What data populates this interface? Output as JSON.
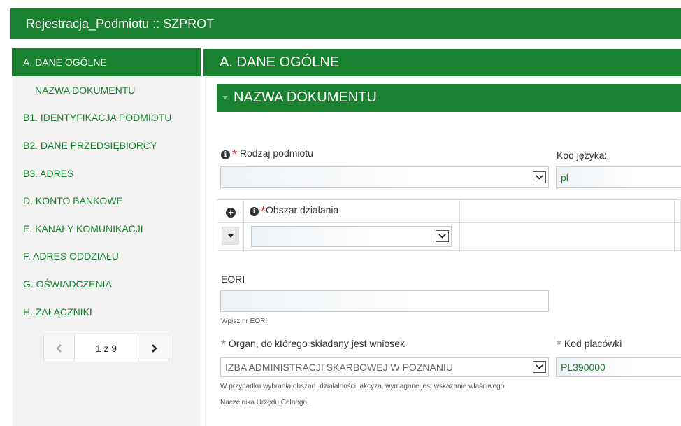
{
  "app": {
    "title": "Rejestracja_Podmiotu :: SZPROT"
  },
  "sidebar": {
    "items": [
      {
        "label": "A. DANE OGÓLNE",
        "active": true
      },
      {
        "label": "NAZWA DOKUMENTU",
        "sub": true
      },
      {
        "label": "B1. IDENTYFIKACJA PODMIOTU"
      },
      {
        "label": "B2. DANE PRZEDSIĘBIORCY"
      },
      {
        "label": "B3. ADRES"
      },
      {
        "label": "D. KONTO BANKOWE"
      },
      {
        "label": "E. KANAŁY KOMUNIKACJI"
      },
      {
        "label": "F. ADRES ODDZIAŁU"
      },
      {
        "label": "G. OŚWIADCZENIA"
      },
      {
        "label": "H. ZAŁĄCZNIKI"
      }
    ],
    "pager": {
      "text": "1 z 9"
    }
  },
  "main": {
    "title": "A. DANE OGÓLNE",
    "section": "NAZWA DOKUMENTU",
    "rodzaj": {
      "label": "Rodzaj podmiotu",
      "value": ""
    },
    "kod_jezyka": {
      "label": "Kod języka:",
      "value": "pl"
    },
    "obszar": {
      "label": "Obszar działania",
      "value": ""
    },
    "eori": {
      "label": "EORI",
      "value": "",
      "hint": "Wpisz nr EORI"
    },
    "organ": {
      "label": "Organ, do którego składany jest wniosek",
      "value": "IZBA ADMINISTRACJI SKARBOWEJ W POZNANIU",
      "hint1": "W przypadku wybrania obszaru działalności: akcyza, wymagane jest wskazanie właściwego",
      "hint2": "Naczelnika Urzędu Celnego."
    },
    "kod_placowki": {
      "label": "Kod placówki",
      "value": "PL390000"
    }
  },
  "colors": {
    "brand_green": "#19812f",
    "required_red": "#d9322b"
  }
}
